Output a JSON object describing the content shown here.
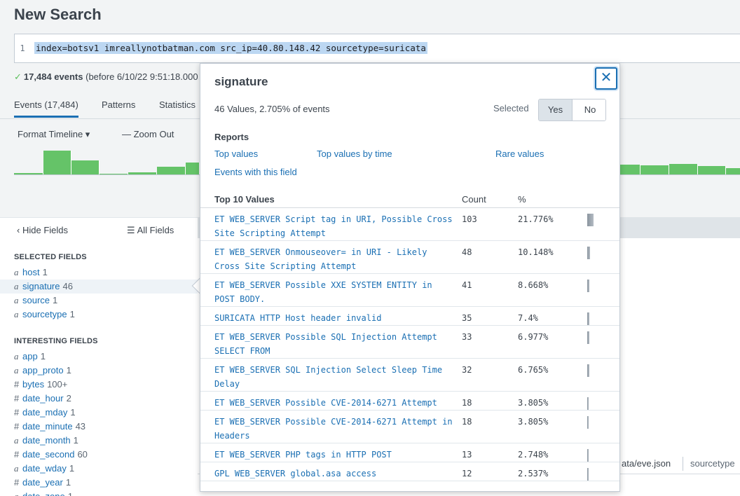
{
  "page": {
    "title": "New Search"
  },
  "search": {
    "line_number": "1",
    "query": "index=botsv1 imreallynotbatman.com src_ip=40.80.148.42 sourcetype=suricata"
  },
  "status": {
    "count": "17,484 events",
    "rest": "(before 6/10/22 9:51:18.000"
  },
  "tabs": [
    {
      "label": "Events (17,484)"
    },
    {
      "label": "Patterns"
    },
    {
      "label": "Statistics"
    }
  ],
  "timeline_tools": {
    "format": "Format Timeline ▾",
    "zoom": "— Zoom Out"
  },
  "timeline": {
    "left_bars": [
      0.05,
      1.0,
      0.58,
      0.0,
      0.08,
      0.33,
      0.5
    ],
    "right_bars": [
      0.4,
      0.38,
      0.44,
      0.35,
      0.25,
      0.05
    ]
  },
  "field_panel": {
    "hide_label": "Hide Fields",
    "all_label": "All Fields",
    "selected_title": "SELECTED FIELDS",
    "selected": [
      {
        "type": "a",
        "name": "host",
        "count": "1"
      },
      {
        "type": "a",
        "name": "signature",
        "count": "46"
      },
      {
        "type": "a",
        "name": "source",
        "count": "1"
      },
      {
        "type": "a",
        "name": "sourcetype",
        "count": "1"
      }
    ],
    "interesting_title": "INTERESTING FIELDS",
    "interesting": [
      {
        "type": "a",
        "name": "app",
        "count": "1"
      },
      {
        "type": "a",
        "name": "app_proto",
        "count": "1"
      },
      {
        "type": "#",
        "name": "bytes",
        "count": "100+"
      },
      {
        "type": "#",
        "name": "date_hour",
        "count": "2"
      },
      {
        "type": "#",
        "name": "date_mday",
        "count": "1"
      },
      {
        "type": "#",
        "name": "date_minute",
        "count": "43"
      },
      {
        "type": "a",
        "name": "date_month",
        "count": "1"
      },
      {
        "type": "#",
        "name": "date_second",
        "count": "60"
      },
      {
        "type": "a",
        "name": "date_wday",
        "count": "1"
      },
      {
        "type": "#",
        "name": "date_year",
        "count": "1"
      },
      {
        "type": "a",
        "name": "date_zone",
        "count": "1"
      }
    ]
  },
  "results": {
    "frag_source": "ata/eve.json",
    "frag_sourcetype": "sourcetype"
  },
  "popover": {
    "title": "signature",
    "close": "✕",
    "summary": "46 Values, 2.705% of events",
    "selected_label": "Selected",
    "yes": "Yes",
    "no": "No",
    "reports_title": "Reports",
    "reports": {
      "top_values": "Top values",
      "top_by_time": "Top values by time",
      "rare": "Rare values",
      "events_with": "Events with this field"
    },
    "table_title": "Top 10 Values",
    "count_header": "Count",
    "pct_header": "%",
    "values": [
      {
        "value": "ET WEB_SERVER Script tag in URI, Possible Cross Site Scripting Attempt",
        "count": "103",
        "pct": "21.776%",
        "frac": 0.21776
      },
      {
        "value": "ET WEB_SERVER Onmouseover= in URI - Likely Cross Site Scripting Attempt",
        "count": "48",
        "pct": "10.148%",
        "frac": 0.10148
      },
      {
        "value": "ET WEB_SERVER Possible XXE SYSTEM ENTITY in POST BODY.",
        "count": "41",
        "pct": "8.668%",
        "frac": 0.08668
      },
      {
        "value": "SURICATA HTTP Host header invalid",
        "count": "35",
        "pct": "7.4%",
        "frac": 0.074
      },
      {
        "value": "ET WEB_SERVER Possible SQL Injection Attempt SELECT FROM",
        "count": "33",
        "pct": "6.977%",
        "frac": 0.06977
      },
      {
        "value": "ET WEB_SERVER SQL Injection Select Sleep Time Delay",
        "count": "32",
        "pct": "6.765%",
        "frac": 0.06765
      },
      {
        "value": "ET WEB_SERVER Possible CVE-2014-6271 Attempt",
        "count": "18",
        "pct": "3.805%",
        "frac": 0.03805
      },
      {
        "value": "ET WEB_SERVER Possible CVE-2014-6271 Attempt in Headers",
        "count": "18",
        "pct": "3.805%",
        "frac": 0.03805
      },
      {
        "value": "ET WEB_SERVER PHP tags in HTTP POST",
        "count": "13",
        "pct": "2.748%",
        "frac": 0.02748
      },
      {
        "value": "GPL WEB_SERVER global.asa access",
        "count": "12",
        "pct": "2.537%",
        "frac": 0.02537
      }
    ]
  }
}
